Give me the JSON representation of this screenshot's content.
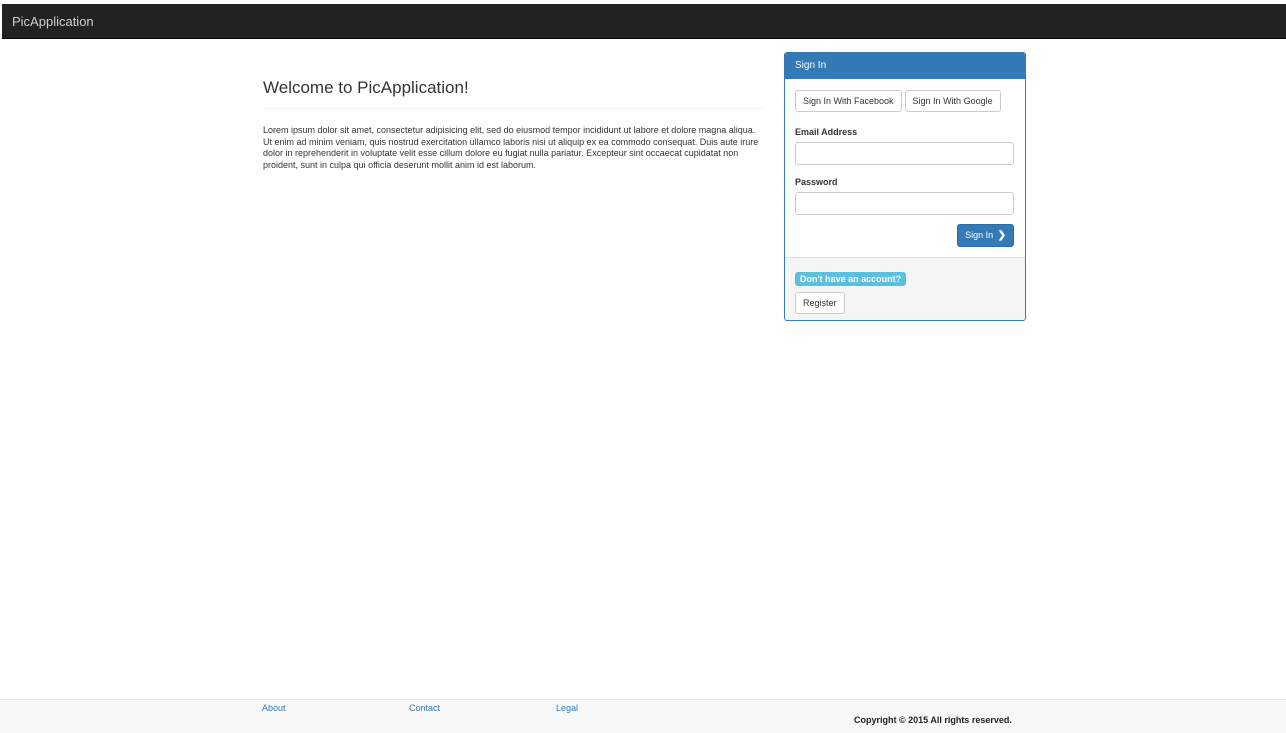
{
  "navbar": {
    "brand": "PicApplication"
  },
  "welcome": {
    "title": "Welcome to PicApplication!",
    "body": "Lorem ipsum dolor sit amet, consectetur adipisicing elit, sed do eiusmod tempor incididunt ut labore et dolore magna aliqua. Ut enim ad minim veniam, quis nostrud exercitation ullamco laboris nisi ut aliquip ex ea commodo consequat. Duis aute irure dolor in reprehenderit in voluptate velit esse cillum dolore eu fugiat nulla pariatur. Excepteur sint occaecat cupidatat non proident, sunt in culpa qui officia deserunt mollit anim id est laborum."
  },
  "signin": {
    "heading": "Sign In",
    "facebook_label": "Sign In With Facebook",
    "google_label": "Sign In With Google",
    "email_label": "Email Address",
    "email_value": "",
    "password_label": "Password",
    "password_value": "",
    "submit_label": "Sign In",
    "submit_icon": "chevron-right-icon",
    "no_account_label": "Don't have an account?",
    "register_label": "Register"
  },
  "footer": {
    "links": [
      {
        "label": "About"
      },
      {
        "label": "Contact"
      },
      {
        "label": "Legal"
      }
    ],
    "copyright": "Copyright © 2015 All rights reserved."
  },
  "colors": {
    "navbar_bg": "#222222",
    "primary": "#337ab7",
    "info": "#5bc0de",
    "link": "#337ab7"
  }
}
